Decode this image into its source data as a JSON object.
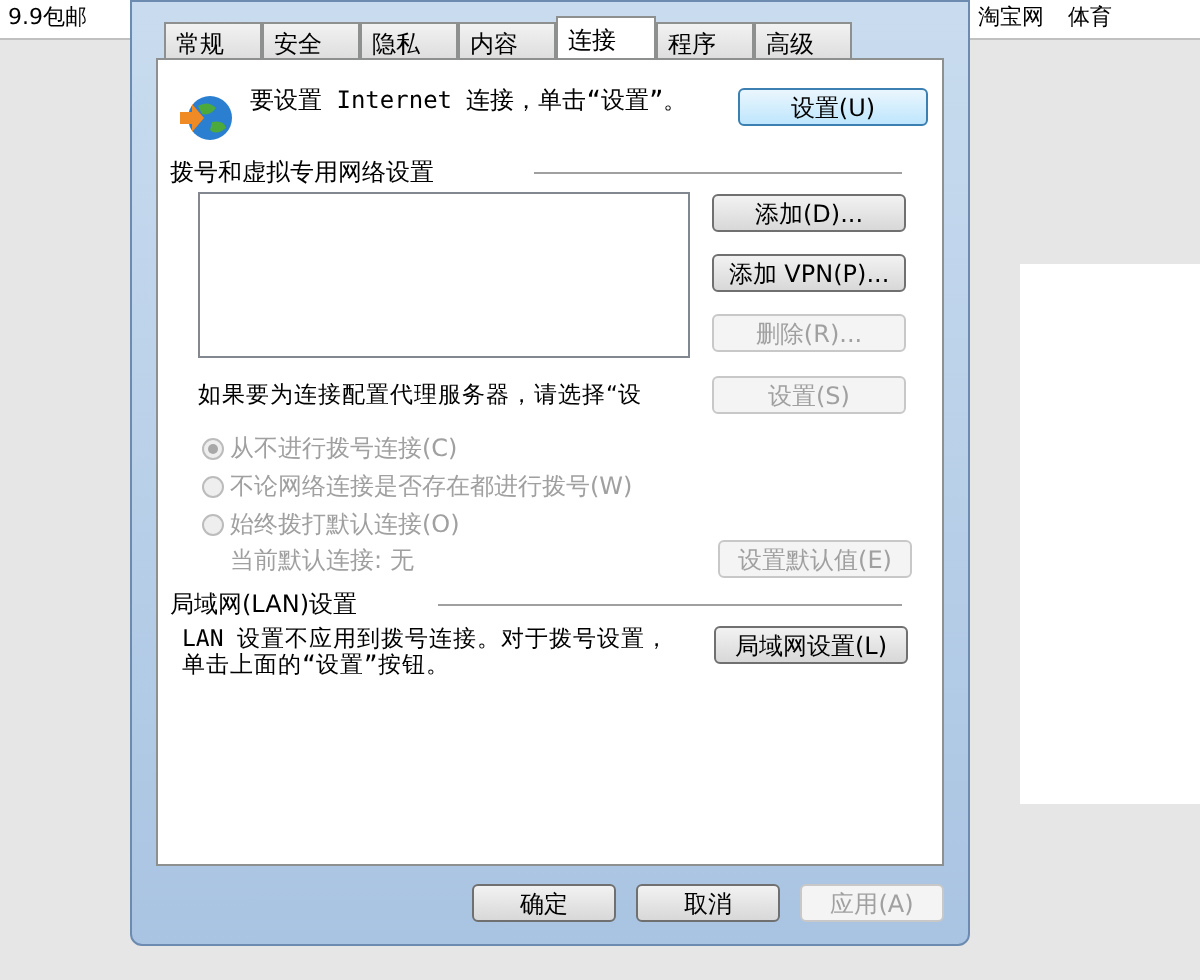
{
  "browser": {
    "left_tabs": [
      "9.9包邮"
    ],
    "right_tabs": [
      "淘宝网",
      "体育"
    ]
  },
  "dialog": {
    "tabs": [
      {
        "label": "常规",
        "selected": false
      },
      {
        "label": "安全",
        "selected": false
      },
      {
        "label": "隐私",
        "selected": false
      },
      {
        "label": "内容",
        "selected": false
      },
      {
        "label": "连接",
        "selected": true
      },
      {
        "label": "程序",
        "selected": false
      },
      {
        "label": "高级",
        "selected": false
      }
    ],
    "intro": {
      "text": "要设置 Internet 连接，单击“设置”。",
      "button": "设置(U)"
    },
    "dialup": {
      "heading": "拨号和虚拟专用网络设置",
      "buttons": [
        {
          "label": "添加(D)...",
          "disabled": false
        },
        {
          "label": "添加 VPN(P)...",
          "disabled": false
        },
        {
          "label": "删除(R)...",
          "disabled": true
        }
      ],
      "proxy_text": "如果要为连接配置代理服务器，请选择“设",
      "proxy_button": {
        "label": "设置(S)",
        "disabled": true
      },
      "radios": [
        {
          "label": "从不进行拨号连接(C)",
          "selected": true,
          "disabled": true
        },
        {
          "label": "不论网络连接是否存在都进行拨号(W)",
          "selected": false,
          "disabled": true
        },
        {
          "label": "始终拨打默认连接(O)",
          "selected": false,
          "disabled": true
        }
      ],
      "current_default": "当前默认连接: 无",
      "default_button": {
        "label": "设置默认值(E)",
        "disabled": true
      }
    },
    "lan": {
      "heading": "局域网(LAN)设置",
      "text": "LAN 设置不应用到拨号连接。对于拨号设置，单击上面的“设置”按钮。",
      "button": "局域网设置(L)"
    },
    "footer": [
      {
        "label": "确定",
        "disabled": false
      },
      {
        "label": "取消",
        "disabled": false
      },
      {
        "label": "应用(A)",
        "disabled": true
      }
    ]
  }
}
